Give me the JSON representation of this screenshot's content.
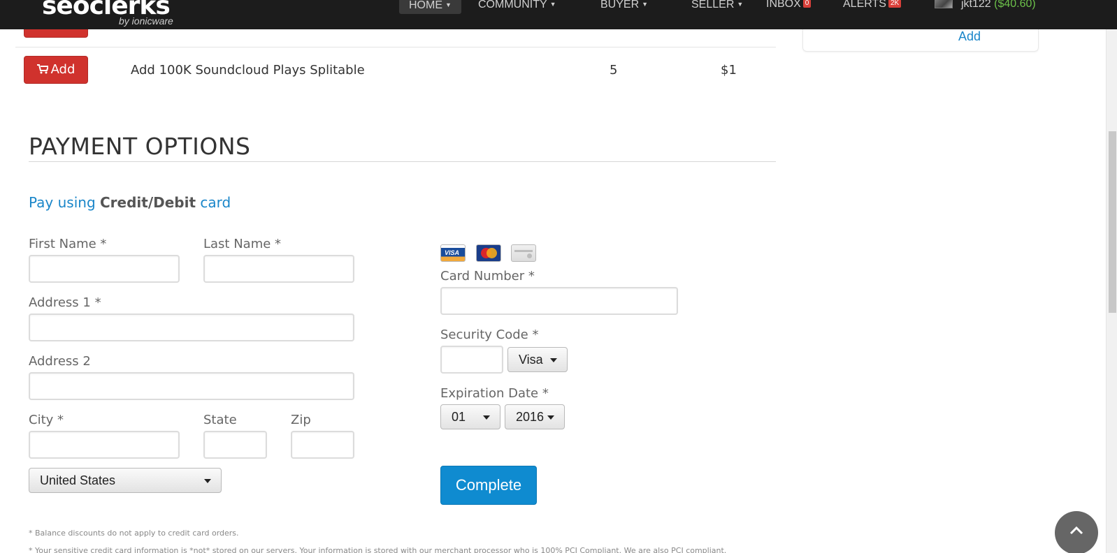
{
  "nav": {
    "logo_text": "seoclerks",
    "logo_sub": "by ionicware",
    "items": [
      {
        "label": "HOME"
      },
      {
        "label": "COMMUNITY"
      },
      {
        "label": "BUYER"
      },
      {
        "label": "SELLER"
      },
      {
        "label": "INBOX",
        "badge": "0"
      },
      {
        "label": "ALERTS",
        "badge": "2K"
      }
    ],
    "username": "jkt122",
    "balance": "($40.60)"
  },
  "side_panel": {
    "link": "Add"
  },
  "products": [
    {
      "button": "Add",
      "name": "Add 100K Soundcloud Plays Splitable",
      "qty": "5",
      "price": "$1"
    }
  ],
  "payment": {
    "title": "PAYMENT OPTIONS",
    "pay_using_prefix": "Pay using",
    "pay_using_method": "Credit/Debit",
    "pay_using_suffix": "card",
    "fields": {
      "first_name": "First Name *",
      "last_name": "Last Name *",
      "address1": "Address 1 *",
      "address2": "Address 2",
      "city": "City *",
      "state": "State",
      "zip": "Zip",
      "card_number": "Card Number *",
      "security_code": "Security Code *",
      "expiration": "Expiration Date *"
    },
    "country": "United States",
    "card_type": "Visa",
    "exp_month": "01",
    "exp_year": "2016",
    "card_icons": [
      "visa-icon",
      "mastercard-icon",
      "generic-card-icon"
    ],
    "complete_button": "Complete"
  },
  "notes": [
    "* Balance discounts do not apply to credit card orders.",
    "* Your sensitive credit card information is *not* stored on our servers. Your information is stored with our merchant processor who is 100% PCI Compliant. We are also PCI compliant."
  ],
  "colors": {
    "nav_bg": "#1c1c1c",
    "add_button": "#d0322d",
    "complete_button": "#0f8bd0",
    "link": "#1a86c9"
  }
}
